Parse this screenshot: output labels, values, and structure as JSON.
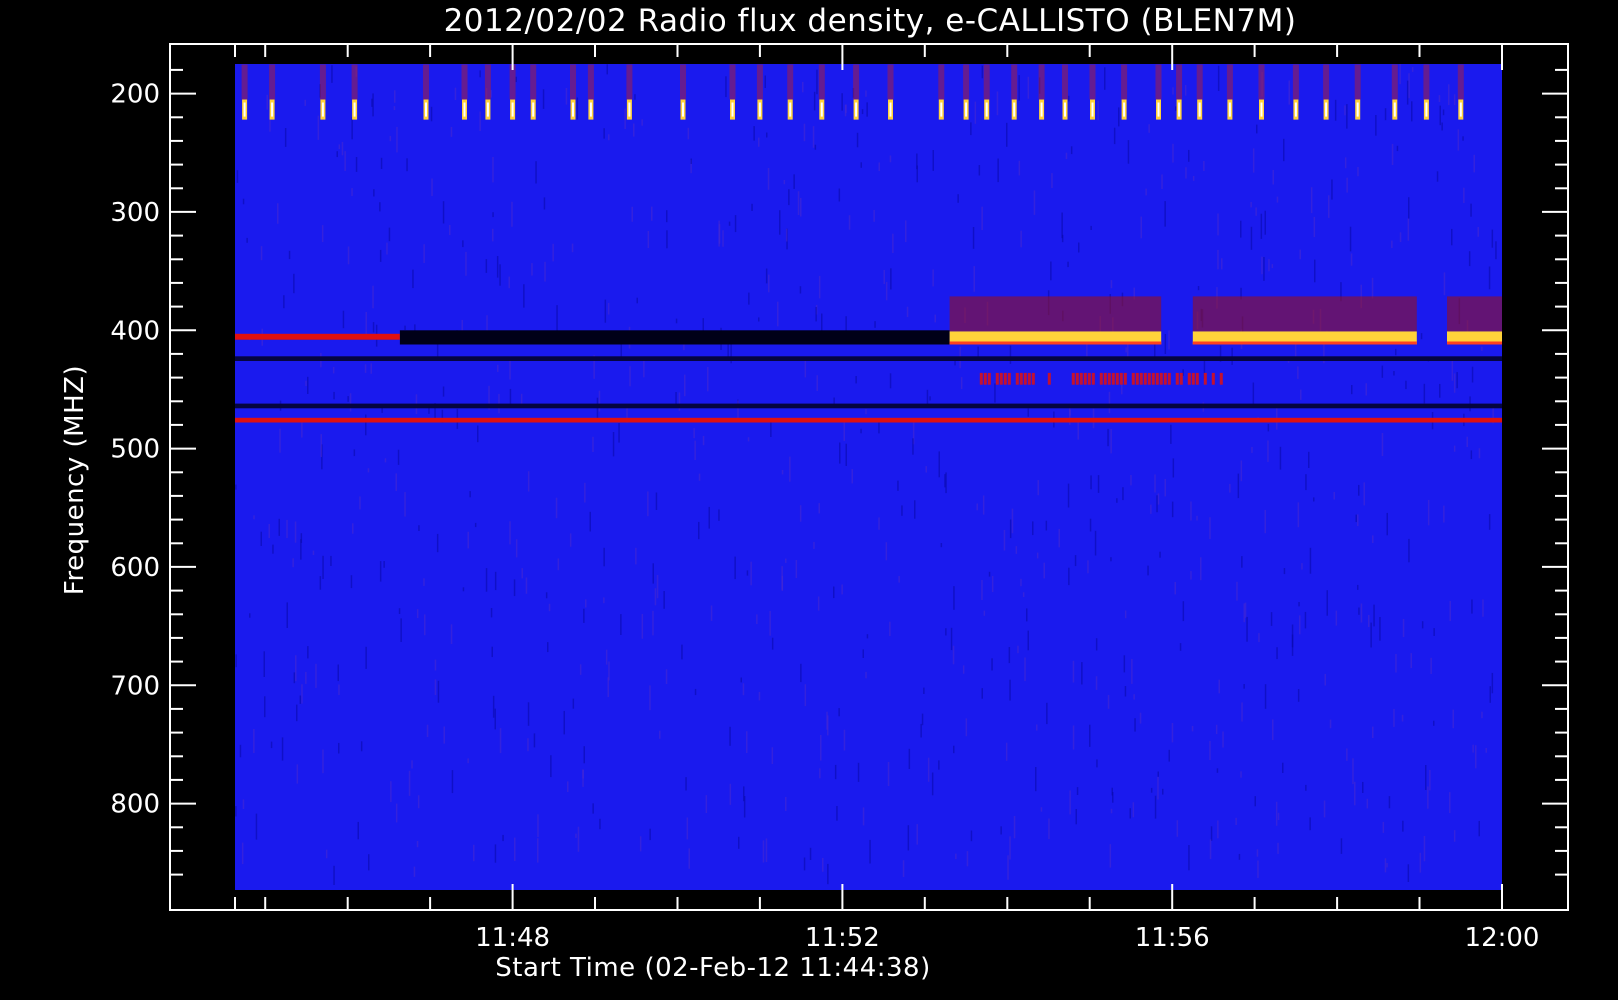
{
  "chart_data": {
    "type": "heatmap",
    "title": "2012/02/02  Radio flux density, e-CALLISTO (BLEN7M)",
    "xlabel": "Start Time (02-Feb-12 11:44:38)",
    "ylabel": "Frequency (MHZ)",
    "x_range": [
      "11:44:38",
      "12:00:00"
    ],
    "y_range_mhz": [
      175,
      873
    ],
    "y_axis_reversed": true,
    "x_ticks": [
      "11:48",
      "11:52",
      "11:56",
      "12:00"
    ],
    "y_ticks": [
      200,
      300,
      400,
      500,
      600,
      700,
      800
    ],
    "colormap": "blue-red-yellow-white",
    "background_color": "#1a1aee",
    "features": [
      {
        "kind": "periodic_bursts",
        "freq_mhz": [
          205,
          222
        ],
        "times": [
          "11:44:45",
          "11:45:05",
          "11:45:42",
          "11:46:05",
          "11:46:57",
          "11:47:25",
          "11:47:42",
          "11:48:00",
          "11:48:15",
          "11:48:44",
          "11:48:57",
          "11:49:25",
          "11:50:04",
          "11:50:40",
          "11:51:00",
          "11:51:22",
          "11:51:45",
          "11:52:10",
          "11:52:35",
          "11:53:12",
          "11:53:30",
          "11:53:45",
          "11:54:05",
          "11:54:25",
          "11:54:42",
          "11:55:02",
          "11:55:25",
          "11:55:50",
          "11:56:05",
          "11:56:20",
          "11:56:42",
          "11:57:05",
          "11:57:30",
          "11:57:52",
          "11:58:15",
          "11:58:42",
          "11:59:05",
          "11:59:30"
        ]
      },
      {
        "kind": "band",
        "freq_mhz": [
          403,
          408
        ],
        "from": "11:44:38",
        "to": "11:46:38",
        "color": "red"
      },
      {
        "kind": "band",
        "freq_mhz": [
          400,
          412
        ],
        "from": "11:46:38",
        "to": "11:53:18",
        "color": "black"
      },
      {
        "kind": "band",
        "freq_mhz": [
          401,
          412
        ],
        "from": "11:53:18",
        "to": "11:55:52",
        "color": "yellow"
      },
      {
        "kind": "band",
        "freq_mhz": [
          401,
          412
        ],
        "from": "11:56:15",
        "to": "11:58:58",
        "color": "yellow"
      },
      {
        "kind": "band",
        "freq_mhz": [
          401,
          412
        ],
        "from": "11:59:20",
        "to": "12:00:00",
        "color": "yellow"
      },
      {
        "kind": "band",
        "freq_mhz": [
          422,
          426
        ],
        "from": "11:44:38",
        "to": "12:00:00",
        "color": "dark"
      },
      {
        "kind": "band",
        "freq_mhz": [
          474,
          478
        ],
        "from": "11:44:38",
        "to": "12:00:00",
        "color": "red"
      },
      {
        "kind": "band",
        "freq_mhz": [
          462,
          466
        ],
        "from": "11:44:38",
        "to": "12:00:00",
        "color": "dark"
      },
      {
        "kind": "bursts",
        "freq_mhz": [
          436,
          446
        ],
        "from": "11:53:40",
        "to": "11:56:42",
        "color": "red"
      }
    ]
  }
}
